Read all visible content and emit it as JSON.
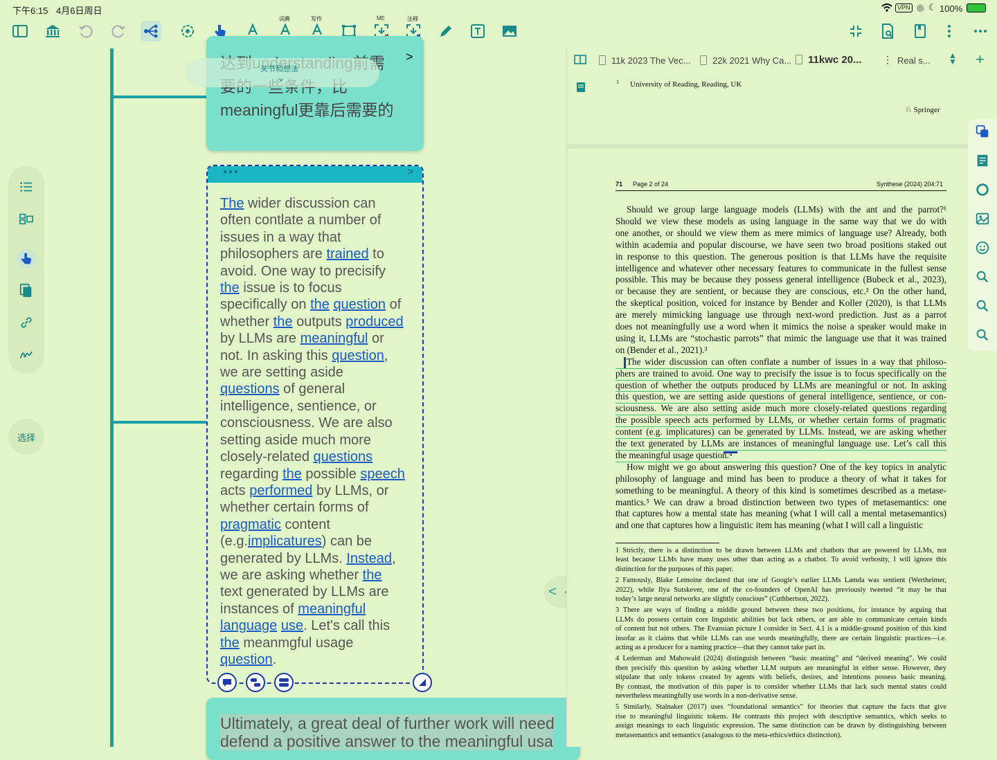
{
  "status": {
    "time": "下午6:15",
    "date": "4月6日周日",
    "battery": "100%",
    "vpn": "VPN"
  },
  "toolbar": {
    "cap_dict": "词典",
    "cap_write": "写作",
    "cap_me": "ME",
    "cap_note": "注释"
  },
  "rail": {
    "select_label": "选择"
  },
  "cards": {
    "top_lines": [
      "达到understanding前需",
      "要的一些条件，比",
      "meaningful更靠后需要的"
    ],
    "ghost_label": "关节和想法",
    "bottom_lines": [
      "Ultimately, a great deal of further work will need",
      "defend a positive answer to the meaningful usa"
    ],
    "sel_body": [
      [
        [
          "The",
          1
        ],
        [
          " wider discussion can",
          0
        ]
      ],
      [
        [
          "often contlate a number of",
          0
        ]
      ],
      [
        [
          "issues in a way that",
          0
        ]
      ],
      [
        [
          "philosophers are ",
          0
        ],
        [
          "trained",
          1
        ],
        [
          " to",
          0
        ]
      ],
      [
        [
          "avoid. One way to precisify",
          0
        ]
      ],
      [
        [
          "the",
          1
        ],
        [
          " issue is to focus",
          0
        ]
      ],
      [
        [
          "specifically on ",
          0
        ],
        [
          "the",
          1
        ],
        [
          " ",
          0
        ],
        [
          "question",
          1
        ],
        [
          " of",
          0
        ]
      ],
      [
        [
          "whether ",
          0
        ],
        [
          "the",
          1
        ],
        [
          " outputs ",
          0
        ],
        [
          "produced",
          1
        ]
      ],
      [
        [
          "by LLMs are ",
          0
        ],
        [
          "meaningful",
          1
        ],
        [
          " or",
          0
        ]
      ],
      [
        [
          "not. In asking this ",
          0
        ],
        [
          "question",
          1
        ],
        [
          ",",
          0
        ]
      ],
      [
        [
          "we are setting aside",
          0
        ]
      ],
      [
        [
          "questions",
          1
        ],
        [
          " of general",
          0
        ]
      ],
      [
        [
          "intelligence, sentience, or",
          0
        ]
      ],
      [
        [
          "consciousness. We are also",
          0
        ]
      ],
      [
        [
          "setting aside much more",
          0
        ]
      ],
      [
        [
          "closely-related ",
          0
        ],
        [
          "questions",
          1
        ]
      ],
      [
        [
          "regarding ",
          0
        ],
        [
          "the",
          1
        ],
        [
          " possible ",
          0
        ],
        [
          "speech",
          1
        ]
      ],
      [
        [
          "acts ",
          0
        ],
        [
          "performed",
          1
        ],
        [
          " by LLMs, or",
          0
        ]
      ],
      [
        [
          "whether certain forms of",
          0
        ]
      ],
      [
        [
          "pragmatic",
          1
        ],
        [
          " content",
          0
        ]
      ],
      [
        [
          "(e.g.",
          0
        ],
        [
          "implicatures",
          1
        ],
        [
          ") can be",
          0
        ]
      ],
      [
        [
          "generated by LLMs. ",
          0
        ],
        [
          "Instead",
          1
        ],
        [
          ",",
          0
        ]
      ],
      [
        [
          "we are asking whether ",
          0
        ],
        [
          "the",
          1
        ]
      ],
      [
        [
          "text generated by LLMs are",
          0
        ]
      ],
      [
        [
          "instances of ",
          0
        ],
        [
          "meaningful",
          1
        ]
      ],
      [
        [
          "language",
          1
        ],
        [
          " ",
          0
        ],
        [
          "use",
          1
        ],
        [
          ". Let's call this",
          0
        ]
      ],
      [
        [
          "the",
          1
        ],
        [
          " meanmgful usage",
          0
        ]
      ],
      [
        [
          "question",
          1
        ],
        [
          ".",
          0
        ]
      ]
    ]
  },
  "tabs": [
    {
      "label": "11k 2023 The Vec..."
    },
    {
      "label": "22k 2021 Why Ca..."
    },
    {
      "label": "11kwc 20..."
    },
    {
      "label": "Real s..."
    }
  ],
  "pdf": {
    "affil_num": "1",
    "affil": "University of Reading, Reading, UK",
    "publisher": "Springer",
    "page_num": "71",
    "page_of": "Page 2 of 24",
    "journal": "Synthese (2024) 204:71",
    "para1": [
      "Should we group large language models (LLMs) with the ant and the parrot?¹",
      "Should we view these models as using language in the same way that we do with",
      "one another, or should we view them as mere mimics of language use? Already, both",
      "within academia and popular discourse, we have seen two broad positions staked out",
      "in response to this question. The generous position is that LLMs have the requisite",
      "intelligence and whatever other necessary features to communicate in the fullest sense",
      "possible. This may be because they possess general intelligence (Bubeck et al., 2023),",
      "or because they are sentient, or because they are conscious, etc.² On the other hand,",
      "the skeptical position, voiced for instance by Bender and Koller (2020), is that LLMs",
      "are merely mimicking language use through next-word prediction. Just as a parrot",
      "does not meaningfully use a word when it mimics the noise a speaker would make in",
      "using it, LLMs are “stochastic parrots” that mimic the language use that it was trained",
      "on (Bender et al., 2021).³"
    ],
    "para2": [
      "The wider discussion can often conflate a number of issues in a way that philoso-",
      "phers are trained to avoid. One way to precisify the issue is to focus specifically on the",
      "question of whether the outputs produced by LLMs are meaningful or not. In asking",
      "this question, we are setting aside questions of general intelligence, sentience, or con-",
      "sciousness. We are also setting aside much more closely-related questions regarding",
      "the possible speech acts performed by LLMs, or whether certain forms of pragmatic",
      "content (e.g. implicatures) can be generated by LLMs. Instead, we are asking whether",
      "the text generated by LLMs are instances of meaningful language use. Let’s call this",
      "the meaningful usage question.⁴"
    ],
    "para3": [
      "How might we go about answering this question? One of the key topics in analytic",
      "philosophy of language and mind has been to produce a theory of what it takes for",
      "something to be meaningful. A theory of this kind is sometimes described as a metase-",
      "mantics.⁵ We can draw a broad distinction between two types of metasemantics: one",
      "that captures how a mental state has meaning (what I will call a mental metasemantics)",
      "and one that captures how a linguistic item has meaning (what I will call a linguistic"
    ],
    "footnotes": [
      [
        "1 Strictly, there is a distinction to be drawn between LLMs and chatbots that are powered by LLMs, not",
        "least because LLMs have many uses other than acting as a chatbot. To avoid verbosity, I will ignore this",
        "distinction for the purposes of this paper."
      ],
      [
        "2 Famously, Blake Lemoine declared that one of Google’s earlier LLMs Lamda was sentient (Wertheimer,",
        "2022), while Ilya Sutskever, one of the co-founders of OpenAI has previously tweeted “it may be that",
        "today’s large neural networks are slightly conscious” (Cuthbertson, 2022)."
      ],
      [
        "3 There are ways of finding a middle ground between these two positions, for instance by arguing that",
        "LLMs do possess certain core linguistic abilities but lack others, or are able to communicate certain kinds",
        "of content but not others. The Evansian picture I consider in Sect. 4.1 is a middle-ground position of this kind",
        "insofar as it claims that while LLMs can use words meaningfully, there are certain linguistic practices—i.e.",
        "acting as a producer for a naming practice—that they cannot take part in."
      ],
      [
        "4 Lederman and Mahowald (2024) distinguish between “basic meaning” and “derived meaning”. We could",
        "then precisify this question by asking whether LLM outputs are meaningful in either sense. However, they",
        "stipulate that only tokens created by agents with beliefs, desires, and intentions possess basic meaning.",
        "By contrast, the motivation of this paper is to consider whether LLMs that lack such mental states could",
        "nevertheless meaningfully use words in a non-derivative sense."
      ],
      [
        "5 Similarly, Stalnaker (2017) uses “foundational semantics” for theories that capture the facts that give",
        "rise to meaningful linguistic tokens. He contrasts this project with descriptive semantics, which seeks to",
        "assign meanings to each linguistic expression. The same distinction can be drawn by distinguishing between",
        "metasemantics and semantics (analogous to the meta-ethics/ethics distinction)."
      ]
    ]
  },
  "nav": {
    "label": "< · >"
  },
  "colors": {
    "bg": "#e2f5c8",
    "teal": "#1ba0a8",
    "card": "#7be0cb",
    "link": "#1a5bc4",
    "select": "#1d3aa8"
  }
}
